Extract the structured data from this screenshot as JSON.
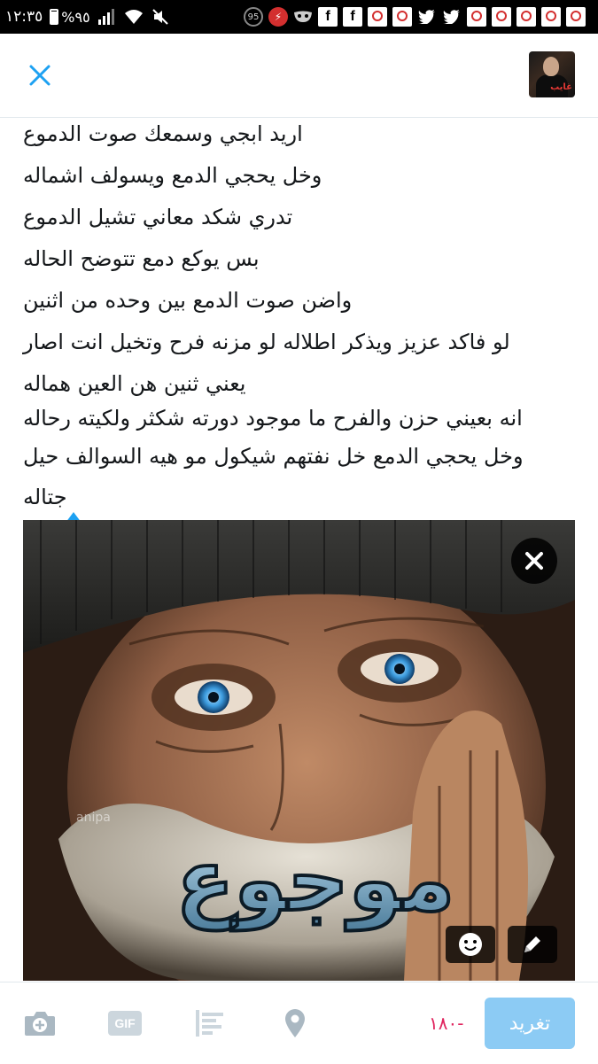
{
  "status_bar": {
    "time": "١٢:٣٥",
    "battery": "%٩٥",
    "notification_badge": "95"
  },
  "header": {
    "avatar_logo_text": "غايب"
  },
  "compose": {
    "lines": [
      "اريد ابجي وسمعك صوت الدموع",
      "وخل يحجي الدمع ويسولف اشماله",
      "تدري شكد معاني تشيل الدموع",
      "بس يوكع دمع تتوضح الحاله",
      "واضن صوت الدمع بين وحده من اثنين",
      "لو فاكد عزيز ويذكر اطلاله  لو مزنه فرح وتخيل انت اصار",
      "يعني ثنين هن العين هماله",
      "انه بعيني حزن والفرح ما موجود دورته شكثر ولكيته رحاله",
      "وخل يحجي الدمع خل نفتهم شيكول مو هيه السوالف حيل",
      "جتاله"
    ]
  },
  "media": {
    "overlay_text": "موجوع",
    "watermark": "anipa"
  },
  "toolbar": {
    "counter": "-١٨٠",
    "tweet_label": "تغريد",
    "gif_label": "GIF"
  },
  "colors": {
    "accent": "#1da1f2",
    "tweet_button_disabled": "#8ccbf4",
    "counter_over_limit": "#e0245e",
    "icon_gray": "#aab8c2"
  }
}
